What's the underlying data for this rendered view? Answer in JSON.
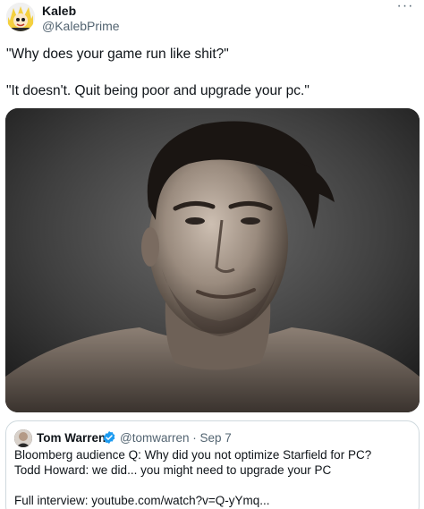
{
  "tweet": {
    "author_name": "Kaleb",
    "author_handle": "@KalebPrime",
    "more_icon": "more-horizontal-icon",
    "lines": [
      "\"Why does your game run like shit?\"",
      "\"It doesn't. Quit being poor and upgrade your pc.\""
    ]
  },
  "quote": {
    "author_name": "Tom Warren",
    "verified_icon": "verified-badge-icon",
    "handle_date": "@tomwarren · Sep 7",
    "lines": [
      "Bloomberg audience Q: Why did you not optimize Starfield for PC?",
      "Todd Howard: we did... you might need to upgrade your PC",
      "Full interview: youtube.com/watch?v=Q-yYmq..."
    ]
  },
  "colors": {
    "text_primary": "#0f1419",
    "text_secondary": "#536471",
    "border": "#cfd9de",
    "verified": "#1d9bf0"
  }
}
